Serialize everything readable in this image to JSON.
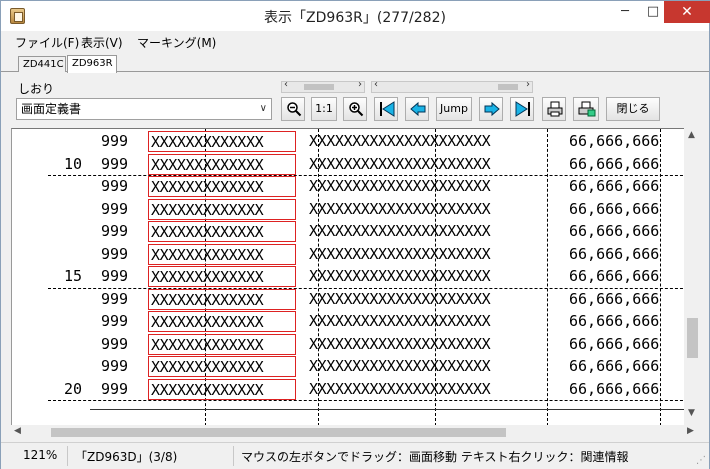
{
  "window": {
    "title": "表示「ZD963R」(277/282)"
  },
  "menu": {
    "file": "ファイル(F)",
    "view": "表示(V)",
    "marking": "マーキング(M)"
  },
  "tabs": [
    "ZD441C",
    "ZD963R"
  ],
  "bookmark": {
    "label": "しおり",
    "selected": "画面定義書"
  },
  "toolbar": {
    "zoom_reset": "1:1",
    "jump": "Jump",
    "close": "閉じる"
  },
  "rows": [
    {
      "num": "",
      "qty": "999",
      "xs": "XXXXXXXXXXXXX",
      "xs2": "XXXXXXXXXXXXXXXXXXXXX",
      "amount": "66,666,666"
    },
    {
      "num": "10",
      "qty": "999",
      "xs": "XXXXXXXXXXXXX",
      "xs2": "XXXXXXXXXXXXXXXXXXXXX",
      "amount": "66,666,666"
    },
    {
      "num": "",
      "qty": "999",
      "xs": "XXXXXXXXXXXXX",
      "xs2": "XXXXXXXXXXXXXXXXXXXXX",
      "amount": "66,666,666"
    },
    {
      "num": "",
      "qty": "999",
      "xs": "XXXXXXXXXXXXX",
      "xs2": "XXXXXXXXXXXXXXXXXXXXX",
      "amount": "66,666,666"
    },
    {
      "num": "",
      "qty": "999",
      "xs": "XXXXXXXXXXXXX",
      "xs2": "XXXXXXXXXXXXXXXXXXXXX",
      "amount": "66,666,666"
    },
    {
      "num": "",
      "qty": "999",
      "xs": "XXXXXXXXXXXXX",
      "xs2": "XXXXXXXXXXXXXXXXXXXXX",
      "amount": "66,666,666"
    },
    {
      "num": "15",
      "qty": "999",
      "xs": "XXXXXXXXXXXXX",
      "xs2": "XXXXXXXXXXXXXXXXXXXXX",
      "amount": "66,666,666"
    },
    {
      "num": "",
      "qty": "999",
      "xs": "XXXXXXXXXXXXX",
      "xs2": "XXXXXXXXXXXXXXXXXXXXX",
      "amount": "66,666,666"
    },
    {
      "num": "",
      "qty": "999",
      "xs": "XXXXXXXXXXXXX",
      "xs2": "XXXXXXXXXXXXXXXXXXXXX",
      "amount": "66,666,666"
    },
    {
      "num": "",
      "qty": "999",
      "xs": "XXXXXXXXXXXXX",
      "xs2": "XXXXXXXXXXXXXXXXXXXXX",
      "amount": "66,666,666"
    },
    {
      "num": "",
      "qty": "999",
      "xs": "XXXXXXXXXXXXX",
      "xs2": "XXXXXXXXXXXXXXXXXXXXX",
      "amount": "66,666,666"
    },
    {
      "num": "20",
      "qty": "999",
      "xs": "XXXXXXXXXXXXX",
      "xs2": "XXXXXXXXXXXXXXXXXXXXX",
      "amount": "66,666,666"
    }
  ],
  "status": {
    "zoom": "121%",
    "doc": "「ZD963D」(3/8)",
    "hint": "マウスの左ボタンでドラッグ：画面移動 テキスト右クリック：関連情報"
  }
}
